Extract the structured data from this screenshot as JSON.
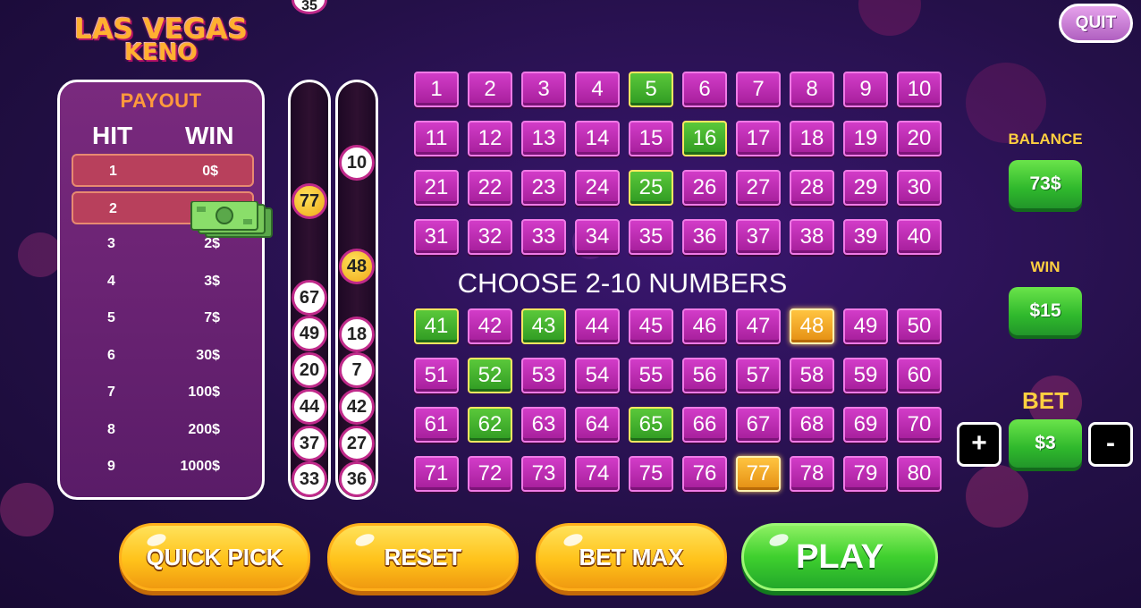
{
  "logo": {
    "line1": "LAS VEGAS",
    "line2": "KENO"
  },
  "quit_label": "QUIT",
  "top_ball": "35",
  "payout": {
    "title": "PAYOUT",
    "hit_header": "HIT",
    "win_header": "WIN",
    "rows": [
      {
        "hit": "1",
        "win": "0$",
        "highlighted": true
      },
      {
        "hit": "2",
        "win": "1$",
        "highlighted": true
      },
      {
        "hit": "3",
        "win": "2$",
        "highlighted": false
      },
      {
        "hit": "4",
        "win": "3$",
        "highlighted": false
      },
      {
        "hit": "5",
        "win": "7$",
        "highlighted": false
      },
      {
        "hit": "6",
        "win": "30$",
        "highlighted": false
      },
      {
        "hit": "7",
        "win": "100$",
        "highlighted": false
      },
      {
        "hit": "8",
        "win": "200$",
        "highlighted": false
      },
      {
        "hit": "9",
        "win": "1000$",
        "highlighted": false
      }
    ]
  },
  "drawn_left": [
    {
      "n": "77",
      "gold": true
    },
    {
      "n": "67",
      "gold": false
    },
    {
      "n": "49",
      "gold": false
    },
    {
      "n": "20",
      "gold": false
    },
    {
      "n": "44",
      "gold": false
    },
    {
      "n": "37",
      "gold": false
    },
    {
      "n": "33",
      "gold": false
    }
  ],
  "drawn_right": [
    {
      "n": "10",
      "gold": false
    },
    {
      "n": "48",
      "gold": true
    },
    {
      "n": "18",
      "gold": false
    },
    {
      "n": "7",
      "gold": false
    },
    {
      "n": "42",
      "gold": false
    },
    {
      "n": "27",
      "gold": false
    },
    {
      "n": "36",
      "gold": false
    }
  ],
  "board": {
    "instruction": "CHOOSE 2-10 NUMBERS",
    "selected_green": [
      5,
      16,
      25,
      41,
      43,
      52,
      62,
      65
    ],
    "matched_gold": [
      48,
      77
    ]
  },
  "balance": {
    "label": "BALANCE",
    "value": "73$"
  },
  "win": {
    "label": "WIN",
    "value": "$15"
  },
  "bet": {
    "label": "BET",
    "value": "$3",
    "plus": "+",
    "minus": "-"
  },
  "buttons": {
    "quick_pick": "QUICK PICK",
    "reset": "RESET",
    "bet_max": "BET MAX",
    "play": "PLAY"
  },
  "colors": {
    "background": "#241048",
    "cell": "#c22fb8",
    "selected": "#3fa82c",
    "matched": "#f0a818",
    "accent_yellow": "#ffd040"
  }
}
